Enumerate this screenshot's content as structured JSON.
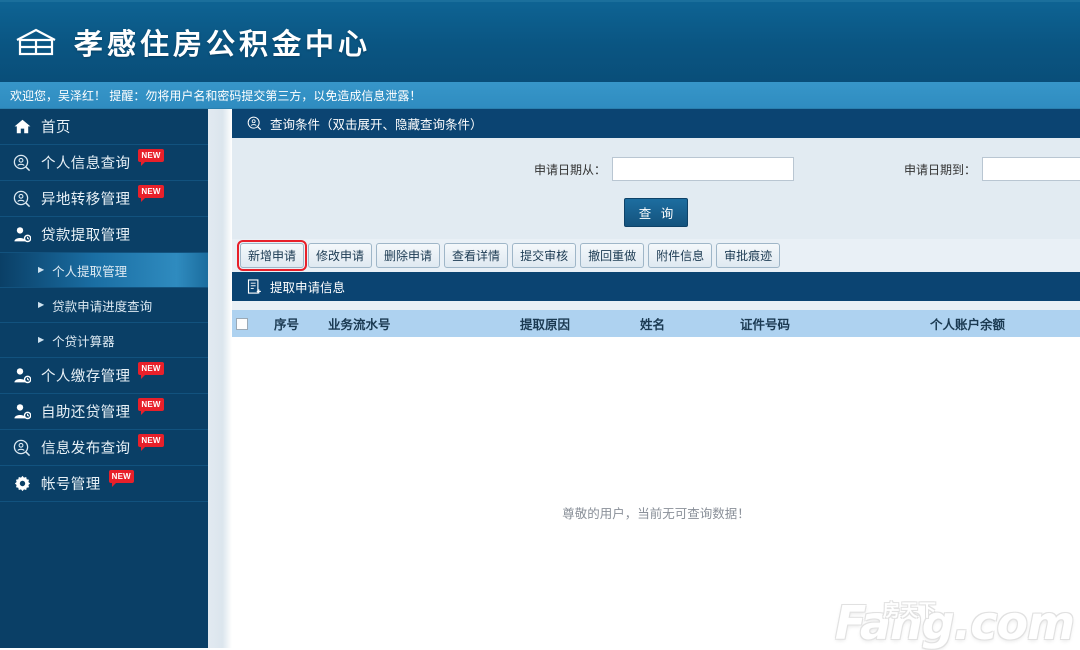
{
  "header": {
    "logo_icon": "building-logo-icon",
    "site_title": "孝感住房公积金中心"
  },
  "welcome_bar": {
    "text": "欢迎您，吴泽红！ 提醒：勿将用户名和密码提交第三方，以免造成信息泄露！"
  },
  "sidebar": {
    "items": [
      {
        "label": "首页",
        "icon": "home-icon",
        "badge": ""
      },
      {
        "label": "个人信息查询",
        "icon": "search-person-icon",
        "badge": "NEW"
      },
      {
        "label": "异地转移管理",
        "icon": "search-person-icon",
        "badge": "NEW"
      },
      {
        "label": "贷款提取管理",
        "icon": "user-clock-icon",
        "badge": ""
      }
    ],
    "sub_items": [
      {
        "label": "个人提取管理",
        "selected": true
      },
      {
        "label": "贷款申请进度查询",
        "selected": false
      },
      {
        "label": "个贷计算器",
        "selected": false
      }
    ],
    "items_after": [
      {
        "label": "个人缴存管理",
        "icon": "user-clock-icon",
        "badge": "NEW"
      },
      {
        "label": "自助还贷管理",
        "icon": "user-clock-icon",
        "badge": "NEW"
      },
      {
        "label": "信息发布查询",
        "icon": "search-person-icon",
        "badge": "NEW"
      },
      {
        "label": "帐号管理",
        "icon": "gear-icon",
        "badge": "NEW"
      }
    ]
  },
  "query_panel": {
    "header_icon": "search-circle-icon",
    "header_title": "查询条件（双击展开、隐藏查询条件）",
    "date_from_label": "申请日期从：",
    "date_from_value": "",
    "date_from_placeholder": "",
    "date_to_label": "申请日期到：",
    "date_to_value": "",
    "date_to_placeholder": "",
    "query_button": "查 询"
  },
  "toolbar": {
    "buttons": [
      {
        "label": "新增申请",
        "highlighted": true
      },
      {
        "label": "修改申请",
        "highlighted": false
      },
      {
        "label": "删除申请",
        "highlighted": false
      },
      {
        "label": "查看详情",
        "highlighted": false
      },
      {
        "label": "提交审核",
        "highlighted": false
      },
      {
        "label": "撤回重做",
        "highlighted": false
      },
      {
        "label": "附件信息",
        "highlighted": false
      },
      {
        "label": "审批痕迹",
        "highlighted": false
      }
    ]
  },
  "list_panel": {
    "header_icon": "document-add-icon",
    "header_title": "提取申请信息",
    "columns": [
      "",
      "序号",
      "业务流水号",
      "提取原因",
      "姓名",
      "证件号码",
      "个人账户余额"
    ],
    "rows": [],
    "empty_message": "尊敬的用户，当前无可查询数据！"
  },
  "watermark": {
    "cn_text": "房天下",
    "main_text": "Fang.com"
  },
  "colors": {
    "header_blue": "#0a5582",
    "welcome_blue": "#2f8cc0",
    "sidebar_navy": "#0a3f66",
    "panel_head": "#0b4472",
    "table_header": "#aed2f0",
    "badge_red": "#e8202a",
    "query_bg": "#e2ebf2"
  }
}
